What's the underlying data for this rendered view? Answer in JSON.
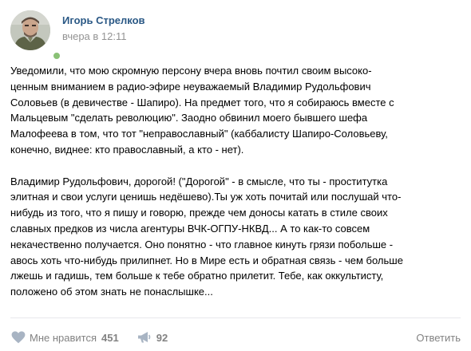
{
  "post": {
    "author": "Игорь Стрелков",
    "date": "вчера в 12:11",
    "paragraphs": [
      "Уведомили, что мою скромную персону вчера вновь почтил своим высоко-\nценным вниманием в радио-эфире неуважаемый Владимир Рудольфович\nСоловьев (в девичестве - Шапиро). На предмет того, что я собираюсь вместе с\nМальцевым \"сделать революцию\". Заодно обвинил моего бывшего шефа\nМалофеева в том, что тот \"неправославный\" (каббалисту Шапиро-Соловьеву,\nконечно, виднее: кто православный, а кто - нет).",
      "Владимир Рудольфович, дорогой! (\"Дорогой\" - в смысле, что ты - проститутка\nэлитная и свои услуги ценишь недёшево).Ты уж хоть почитай или послушай что-\nнибудь из того, что я пишу и говорю, прежде чем доносы катать в стиле своих\nславных предков из числа агентуры ВЧК-ОГПУ-НКВД... А то как-то совсем\nнекачественно получается. Оно понятно - что главное кинуть грязи побольше -\nавось хоть что-нибудь прилипнет. Но в Мире есть и обратная связь - чем больше\nлжешь и гадишь, тем больше к тебе обратно прилетит. Тебе, как оккультисту,\nположено об этом знать не понаслышке..."
    ]
  },
  "actions": {
    "like_label": "Мне нравится",
    "like_count": "451",
    "share_count": "92",
    "views_label": "Ответить"
  },
  "icons": {
    "like": "heart-icon",
    "share": "megaphone-icon"
  },
  "colors": {
    "author_link": "#2a5885",
    "meta_gray": "#939393",
    "action_gray": "#828282",
    "icon_gray": "#a8b4c3",
    "online": "#8ac176",
    "divider": "#e7e8ec"
  }
}
